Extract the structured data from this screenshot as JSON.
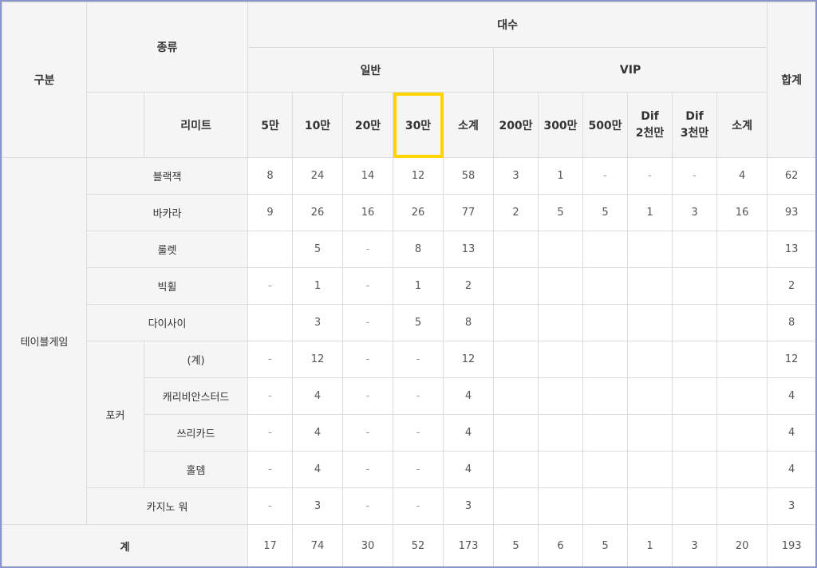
{
  "header": {
    "gubun": "구분",
    "jongryu": "종류",
    "daesu": "대수",
    "ilban": "일반",
    "vip": "VIP",
    "hapgye": "합계",
    "limit": "리미트",
    "ilban_cols": [
      "5만",
      "10만",
      "20만",
      "30만",
      "소계"
    ],
    "vip_cols": [
      "200만",
      "300만",
      "500만",
      "Dif",
      "Dif",
      "소계"
    ],
    "vip_cols_line2": [
      "",
      "",
      "",
      "2천만",
      "3천만",
      ""
    ]
  },
  "category": "테이블게임",
  "poker_label": "포커",
  "rows": [
    {
      "name": "블랙잭",
      "cells": [
        "8",
        "24",
        "14",
        "12",
        "58",
        "3",
        "1",
        "-",
        "-",
        "-",
        "4",
        "62"
      ]
    },
    {
      "name": "바카라",
      "cells": [
        "9",
        "26",
        "16",
        "26",
        "77",
        "2",
        "5",
        "5",
        "1",
        "3",
        "16",
        "93"
      ]
    },
    {
      "name": "룰렛",
      "cells": [
        "",
        "5",
        "-",
        "8",
        "13",
        "",
        "",
        "",
        "",
        "",
        "",
        "13"
      ]
    },
    {
      "name": "빅휠",
      "cells": [
        "-",
        "1",
        "-",
        "1",
        "2",
        "",
        "",
        "",
        "",
        "",
        "",
        "2"
      ]
    },
    {
      "name": "다이사이",
      "cells": [
        "",
        "3",
        "-",
        "5",
        "8",
        "",
        "",
        "",
        "",
        "",
        "",
        "8"
      ]
    },
    {
      "name": "(계)",
      "cells": [
        "-",
        "12",
        "-",
        "-",
        "12",
        "",
        "",
        "",
        "",
        "",
        "",
        "12"
      ]
    },
    {
      "name": "캐리비안스터드",
      "cells": [
        "-",
        "4",
        "-",
        "-",
        "4",
        "",
        "",
        "",
        "",
        "",
        "",
        "4"
      ]
    },
    {
      "name": "쓰리카드",
      "cells": [
        "-",
        "4",
        "-",
        "-",
        "4",
        "",
        "",
        "",
        "",
        "",
        "",
        "4"
      ]
    },
    {
      "name": "홀뎀",
      "cells": [
        "-",
        "4",
        "-",
        "-",
        "4",
        "",
        "",
        "",
        "",
        "",
        "",
        "4"
      ]
    },
    {
      "name": "카지노 워",
      "cells": [
        "-",
        "3",
        "-",
        "-",
        "3",
        "",
        "",
        "",
        "",
        "",
        "",
        "3"
      ]
    }
  ],
  "total": {
    "label": "계",
    "cells": [
      "17",
      "74",
      "30",
      "52",
      "173",
      "5",
      "6",
      "5",
      "1",
      "3",
      "20",
      "193"
    ]
  },
  "colors": {
    "highlight": "#ffd400",
    "header_bg": "#f5f5f5",
    "border": "#dcdcdc",
    "frame": "#8a96c8"
  }
}
